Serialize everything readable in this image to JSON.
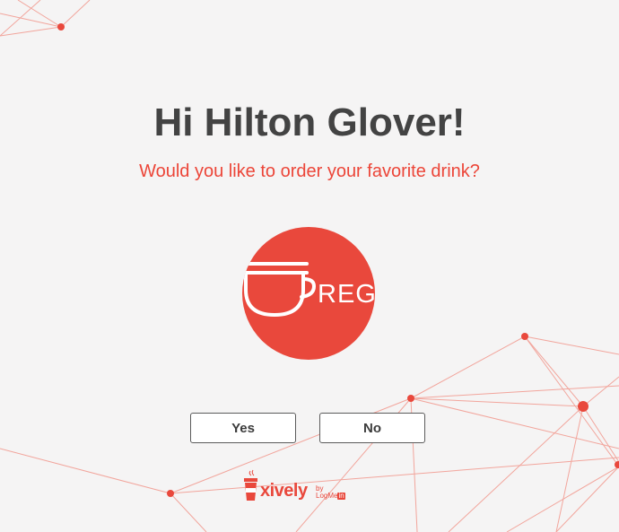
{
  "greeting": {
    "text": "Hi Hilton Glover!"
  },
  "question": {
    "text": "Would you like to order your favorite drink?"
  },
  "drink": {
    "label": "REG",
    "icon": "coffee-cup-icon",
    "badge_color": "#e9483c"
  },
  "actions": {
    "yes_label": "Yes",
    "no_label": "No"
  },
  "brand": {
    "name": "xively",
    "by": "by",
    "partner_prefix": "LogMe",
    "partner_suffix": "in",
    "icon": "coffee-cup-logo-icon"
  },
  "colors": {
    "accent": "#ec4538",
    "heading": "#434343",
    "background": "#f5f4f4",
    "network_line": "#f2a59c"
  }
}
